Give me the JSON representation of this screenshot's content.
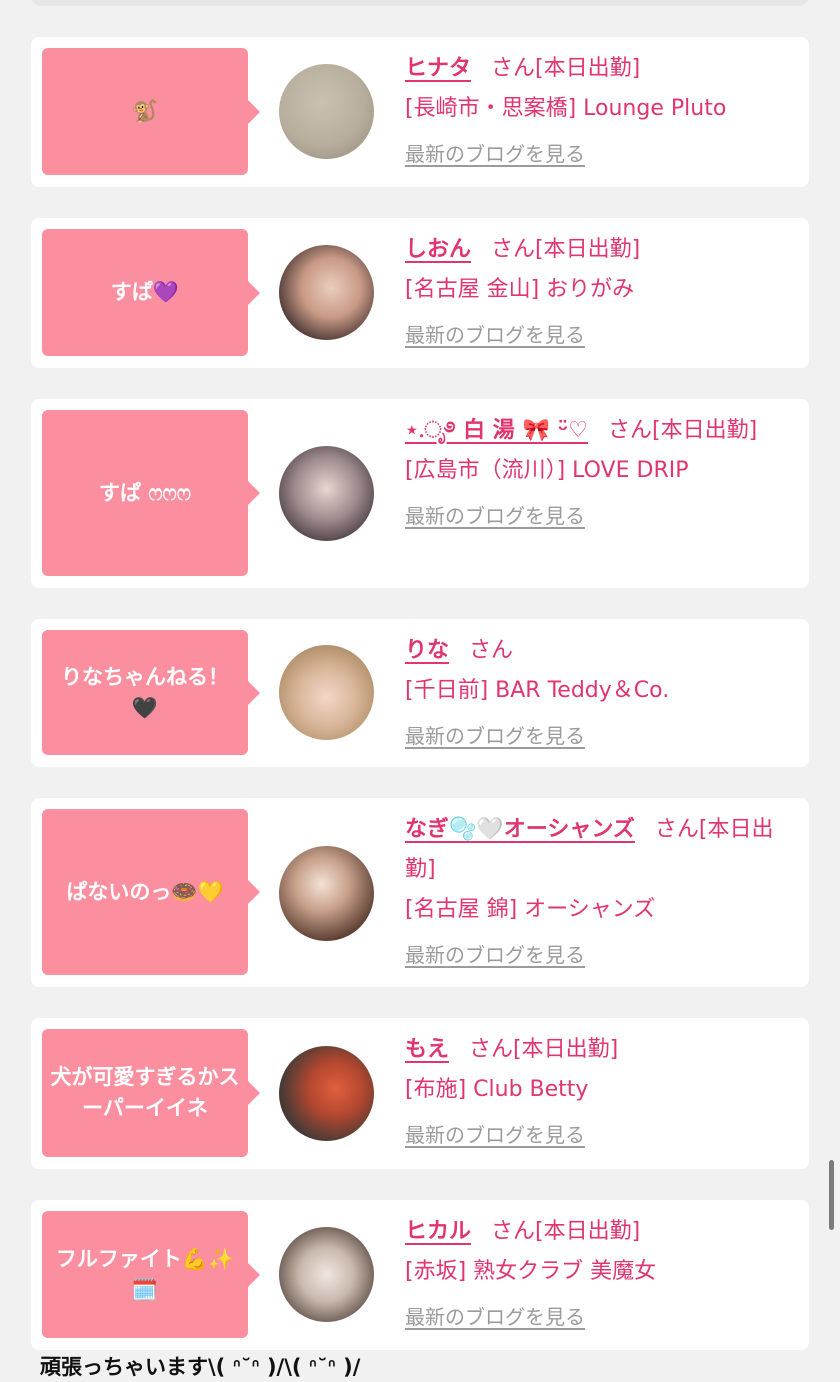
{
  "blog_link_label": "最新のブログを見る",
  "honorific": "さん",
  "cards": [
    {
      "bubble": "🐒",
      "name": "ヒナタ",
      "status": "[本日出勤]",
      "shop": "[長崎市・思案橋] Lounge Pluto"
    },
    {
      "bubble": "すぱ💜",
      "name": "しおん",
      "status": "[本日出勤]",
      "shop": "[名古屋 金山] おりがみ"
    },
    {
      "bubble": "すぱ ෆ‪ෆ‪ෆ",
      "name": "⋆.ೃ࿔ 白 湯 🎀 ᵕ̈♡",
      "status": "[本日出勤]",
      "shop": "[広島市（流川）] LOVE DRIP"
    },
    {
      "bubble": "りなちゃんねる！🖤",
      "name": "りな",
      "status": "",
      "shop": "[千日前] BAR Teddy＆Co."
    },
    {
      "bubble": "ぱないのっ🍩💛",
      "name": "なぎ🫧🤍オーシャンズ",
      "status": "[本日出勤]",
      "shop": "[名古屋 錦] オーシャンズ"
    },
    {
      "bubble": "犬が可愛すぎるかスーパーイイネ",
      "name": "もえ",
      "status": "[本日出勤]",
      "shop": "[布施] Club Betty"
    },
    {
      "bubble": "フルファイト💪✨🗓️",
      "name": "ヒカル",
      "status": "[本日出勤]",
      "shop": "[赤坂] 熟女クラブ 美魔女"
    }
  ],
  "bottom_text": "頑張っちゃいます\\( ᐢ˘ᐢ )/\\( ᐢ˘ᐢ )/",
  "colors": {
    "bubble": "#fb8f9f",
    "accent": "#e0356f",
    "link": "#9b9b9b",
    "background": "#f1f1f1"
  }
}
